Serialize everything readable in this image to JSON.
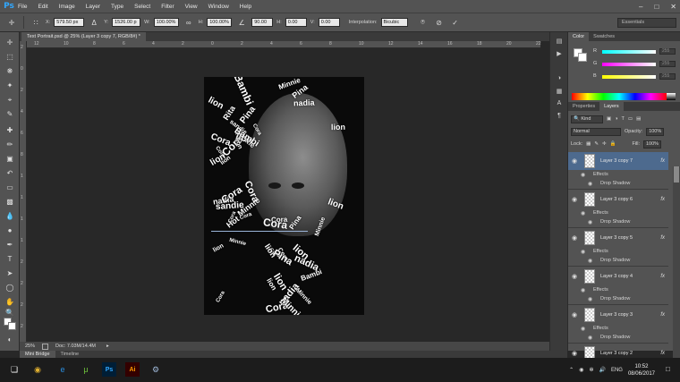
{
  "app": {
    "logo": "Ps",
    "menu": [
      "File",
      "Edit",
      "Image",
      "Layer",
      "Type",
      "Select",
      "Filter",
      "View",
      "Window",
      "Help"
    ]
  },
  "options": {
    "x_label": "X:",
    "x_value": "579.50 px",
    "y_label": "Y:",
    "y_value": "1526.00 p",
    "w_label": "W:",
    "w_value": "100.00%",
    "h_label": "H:",
    "h_value": "100.00%",
    "angle_value": "90.00",
    "hskew_label": "H:",
    "hskew_value": "0.00",
    "vskew_label": "V:",
    "vskew_value": "0.00",
    "interp_label": "Interpolation:",
    "interp_value": "Bicubic",
    "workspace": "Essentials"
  },
  "document": {
    "tab_title": "Text Portrait.psd @ 25% (Layer 3 copy 7, RGB/8#) *",
    "ruler_h": [
      "12",
      "10",
      "8",
      "6",
      "4",
      "2",
      "0",
      "2",
      "4",
      "6",
      "8",
      "10",
      "12",
      "14",
      "16",
      "18",
      "20",
      "22"
    ],
    "ruler_v": [
      "2",
      "0",
      "2",
      "4",
      "6",
      "8",
      "1",
      "1",
      "1",
      "1",
      "2",
      "2",
      "2",
      "2"
    ],
    "zoom": "25%",
    "doc_size": "Doc: 7.03M/14.4M"
  },
  "canvas_words": [
    "lion",
    "Cora",
    "Minnie",
    "Pina",
    "nadia",
    "Bambi",
    "Cora",
    "lion",
    "Hot",
    "sandie",
    "Cora",
    "Minnie",
    "lion",
    "Rita",
    "Cora",
    "lion",
    "nadia",
    "Pina",
    "Cora",
    "lion",
    "Minnie",
    "Bambi",
    "Cora",
    "lion",
    "sandie",
    "Cora",
    "lion",
    "Minnie",
    "Cora",
    "nadia",
    "Cora",
    "lion",
    "Minnie",
    "Pina",
    "Cora",
    "lion",
    "Bambi",
    "Cora",
    "Minnie",
    "lion",
    "Cora",
    "nadia",
    "Cora",
    "lion",
    "Minnie",
    "Cora",
    "lion",
    "Pina"
  ],
  "bottom_tabs": [
    "Mini Bridge",
    "Timeline"
  ],
  "color_panel": {
    "tabs": [
      "Color",
      "Swatches"
    ],
    "sliders": [
      {
        "label": "R",
        "value": "255",
        "color": "#ff3c3c"
      },
      {
        "label": "G",
        "value": "255",
        "color": "#ff3cd8"
      },
      {
        "label": "B",
        "value": "255",
        "color": "#ffee3c"
      }
    ]
  },
  "layers_panel": {
    "tabs": [
      "Properties",
      "Layers"
    ],
    "kind": "Kind",
    "blend_mode": "Normal",
    "opacity_label": "Opacity:",
    "opacity_value": "100%",
    "lock_label": "Lock:",
    "fill_label": "Fill:",
    "fill_value": "100%",
    "effects_label": "Effects",
    "drop_shadow_label": "Drop Shadow",
    "fx_label": "fx",
    "layers": [
      {
        "name": "Layer 3 copy 7",
        "selected": true
      },
      {
        "name": "Layer 3 copy 6",
        "selected": false
      },
      {
        "name": "Layer 3 copy 5",
        "selected": false
      },
      {
        "name": "Layer 3 copy 4",
        "selected": false
      },
      {
        "name": "Layer 3 copy 3",
        "selected": false
      },
      {
        "name": "Layer 3 copy 2",
        "selected": false
      }
    ]
  },
  "taskbar": {
    "language": "ENG",
    "time": "10:52",
    "date": "08/06/2017"
  },
  "icons": {
    "start": "windows-icon",
    "chrome": "chrome-icon",
    "ie": "internet-explorer-icon",
    "utorrent": "utorrent-icon",
    "photoshop": "photoshop-icon",
    "illustrator": "illustrator-icon",
    "steam": "steam-icon"
  },
  "colors": {
    "accent": "#31a8ff",
    "selected_layer": "#4d6a8e",
    "panel_bg": "#535353",
    "canvas_bg": "#282828"
  }
}
